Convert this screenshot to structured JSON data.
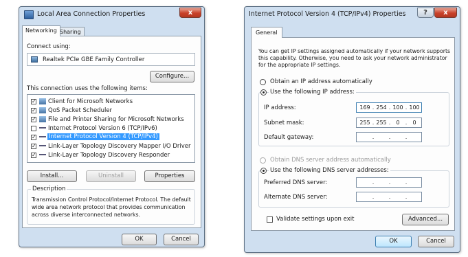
{
  "lac": {
    "title": "Local Area Connection Properties",
    "tabs": [
      "Networking",
      "Sharing"
    ],
    "connect_using_label": "Connect using:",
    "adapter": "Realtek PCIe GBE Family Controller",
    "configure_button": "Configure...",
    "items_label": "This connection uses the following items:",
    "items": [
      {
        "label": "Client for Microsoft Networks",
        "checked": true,
        "icon": "client-icon"
      },
      {
        "label": "QoS Packet Scheduler",
        "checked": true,
        "icon": "scheduler-icon"
      },
      {
        "label": "File and Printer Sharing for Microsoft Networks",
        "checked": true,
        "icon": "share-icon"
      },
      {
        "label": "Internet Protocol Version 6 (TCP/IPv6)",
        "checked": false,
        "icon": "protocol-icon"
      },
      {
        "label": "Internet Protocol Version 4 (TCP/IPv4)",
        "checked": true,
        "icon": "protocol-icon",
        "selected": true
      },
      {
        "label": "Link-Layer Topology Discovery Mapper I/O Driver",
        "checked": true,
        "icon": "protocol-icon"
      },
      {
        "label": "Link-Layer Topology Discovery Responder",
        "checked": true,
        "icon": "protocol-icon"
      }
    ],
    "install_button": "Install...",
    "uninstall_button": "Uninstall",
    "properties_button": "Properties",
    "description_title": "Description",
    "description_lines": [
      "Transmission Control Protocol/Internet Protocol. The default",
      "wide area network protocol that provides communication",
      "across diverse interconnected networks."
    ],
    "ok_button": "OK",
    "cancel_button": "Cancel",
    "close_glyph": "x"
  },
  "ipv4": {
    "title": "Internet Protocol Version 4 (TCP/IPv4) Properties",
    "help_glyph": "?",
    "close_glyph": "x",
    "tab": "General",
    "intro_lines": [
      "You can get IP settings assigned automatically if your network supports",
      "this capability. Otherwise, you need to ask your network administrator",
      "for the appropriate IP settings."
    ],
    "obtain_ip_auto": "Obtain an IP address automatically",
    "use_following_ip": "Use the following IP address:",
    "ip_address_label": "IP address:",
    "ip_address": [
      "169",
      "254",
      "100",
      "100"
    ],
    "subnet_label": "Subnet mask:",
    "subnet_mask": [
      "255",
      "255",
      "0",
      "0"
    ],
    "gateway_label": "Default gateway:",
    "obtain_dns_auto": "Obtain DNS server address automatically",
    "use_following_dns": "Use the following DNS server addresses:",
    "preferred_dns_label": "Preferred DNS server:",
    "alternate_dns_label": "Alternate DNS server:",
    "validate_label": "Validate settings upon exit",
    "advanced_button": "Advanced...",
    "ok_button": "OK",
    "cancel_button": "Cancel"
  }
}
